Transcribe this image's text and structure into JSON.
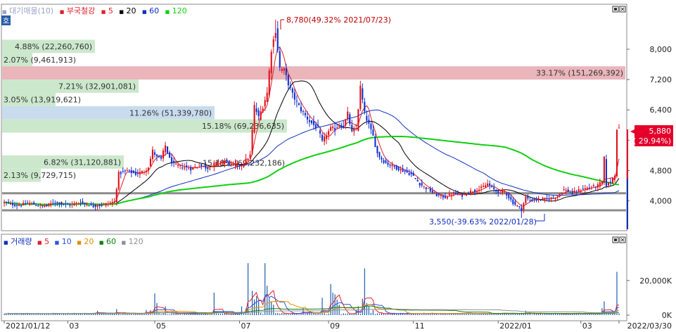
{
  "price_panel": {
    "menu_button_label": "호",
    "legend": [
      {
        "label": "대기매물(10)",
        "color": "#9aa4c8"
      },
      {
        "label": "부국철강",
        "color": "#e0202a"
      },
      {
        "label": "5",
        "color": "#e0202a"
      },
      {
        "label": "20",
        "color": "#000000"
      },
      {
        "label": "60",
        "color": "#1030c0"
      },
      {
        "label": "120",
        "color": "#10d010"
      }
    ],
    "legend_markers": [
      "■",
      "■",
      "■",
      "■",
      "■",
      "■"
    ],
    "max_annotation": "8,780(49.32% 2021/07/23)",
    "min_annotation": "3,550(-39.63% 2022/01/28)",
    "current_price": "5,880",
    "current_change": "( 29.94%)"
  },
  "volume_panel": {
    "legend": [
      {
        "label": "거래량",
        "color": "#1030c0"
      },
      {
        "label": "5",
        "color": "#e0202a"
      },
      {
        "label": "10",
        "color": "#3050e0"
      },
      {
        "label": "20",
        "color": "#e09000"
      },
      {
        "label": "60",
        "color": "#108010"
      },
      {
        "label": "120",
        "color": "#909090"
      }
    ],
    "legend_markers": [
      "■",
      "■",
      "■",
      "■",
      "■",
      "■"
    ]
  },
  "chart_data": {
    "type": "candlestick",
    "price_axis_ticks": [
      "8,000",
      "7,200",
      "6,400",
      "5,600",
      "4,800",
      "4,000"
    ],
    "price_axis_values": [
      8000,
      7200,
      6400,
      5600,
      4800,
      4000
    ],
    "ylim": [
      3250,
      9150
    ],
    "volume_axis_ticks": [
      "20,000K",
      "0K"
    ],
    "volume_axis_values": [
      20000,
      0
    ],
    "volume_ylim": [
      0,
      39000
    ],
    "x_ticks": [
      {
        "label": "2021/01/12",
        "i": 0
      },
      {
        "label": "03",
        "i": 30
      },
      {
        "label": "05",
        "i": 71
      },
      {
        "label": "07",
        "i": 111
      },
      {
        "label": "09",
        "i": 153
      },
      {
        "label": "11",
        "i": 193
      },
      {
        "label": "2022/01",
        "i": 233
      },
      {
        "label": "03",
        "i": 272
      },
      {
        "label": "2022/03/30",
        "i": 290
      }
    ],
    "n_days": 291,
    "close_anchors": [
      [
        0,
        3960
      ],
      [
        6,
        3880
      ],
      [
        12,
        3940
      ],
      [
        18,
        3850
      ],
      [
        24,
        3960
      ],
      [
        30,
        3890
      ],
      [
        36,
        3960
      ],
      [
        42,
        3860
      ],
      [
        48,
        3920
      ],
      [
        52,
        3980
      ],
      [
        54,
        4720
      ],
      [
        58,
        4800
      ],
      [
        62,
        4710
      ],
      [
        66,
        4780
      ],
      [
        68,
        4900
      ],
      [
        70,
        5320
      ],
      [
        72,
        5150
      ],
      [
        74,
        5100
      ],
      [
        76,
        5460
      ],
      [
        78,
        5100
      ],
      [
        80,
        4950
      ],
      [
        84,
        4900
      ],
      [
        88,
        4850
      ],
      [
        92,
        4930
      ],
      [
        96,
        4870
      ],
      [
        100,
        5000
      ],
      [
        104,
        5050
      ],
      [
        108,
        4950
      ],
      [
        112,
        4950
      ],
      [
        116,
        5200
      ],
      [
        118,
        6500
      ],
      [
        120,
        6200
      ],
      [
        122,
        6500
      ],
      [
        124,
        6850
      ],
      [
        126,
        8000
      ],
      [
        128,
        8500
      ],
      [
        130,
        7500
      ],
      [
        132,
        7450
      ],
      [
        134,
        7100
      ],
      [
        136,
        6800
      ],
      [
        140,
        6400
      ],
      [
        144,
        6100
      ],
      [
        148,
        5900
      ],
      [
        150,
        5550
      ],
      [
        152,
        5750
      ],
      [
        154,
        5900
      ],
      [
        156,
        5900
      ],
      [
        158,
        6000
      ],
      [
        160,
        5950
      ],
      [
        162,
        6300
      ],
      [
        164,
        5800
      ],
      [
        166,
        5900
      ],
      [
        168,
        7000
      ],
      [
        170,
        6300
      ],
      [
        172,
        6000
      ],
      [
        174,
        5700
      ],
      [
        176,
        5250
      ],
      [
        178,
        5100
      ],
      [
        180,
        5000
      ],
      [
        184,
        4900
      ],
      [
        188,
        4800
      ],
      [
        192,
        4700
      ],
      [
        196,
        4450
      ],
      [
        200,
        4300
      ],
      [
        204,
        4150
      ],
      [
        208,
        4100
      ],
      [
        212,
        4200
      ],
      [
        216,
        4150
      ],
      [
        220,
        4250
      ],
      [
        224,
        4300
      ],
      [
        228,
        4450
      ],
      [
        232,
        4250
      ],
      [
        236,
        4250
      ],
      [
        240,
        3950
      ],
      [
        244,
        3780
      ],
      [
        246,
        4100
      ],
      [
        248,
        4000
      ],
      [
        252,
        4050
      ],
      [
        256,
        4050
      ],
      [
        260,
        4100
      ],
      [
        264,
        4300
      ],
      [
        268,
        4200
      ],
      [
        272,
        4300
      ],
      [
        276,
        4350
      ],
      [
        280,
        4400
      ],
      [
        282,
        4500
      ],
      [
        283,
        5120
      ],
      [
        284,
        4420
      ],
      [
        286,
        4500
      ],
      [
        288,
        4700
      ],
      [
        289,
        5880
      ]
    ],
    "volume_spikes": [
      [
        44,
        2500
      ],
      [
        53,
        3500
      ],
      [
        67,
        3000
      ],
      [
        69,
        2800
      ],
      [
        71,
        12500
      ],
      [
        72,
        7000
      ],
      [
        76,
        5000
      ],
      [
        99,
        13000
      ],
      [
        112,
        5000
      ],
      [
        114,
        3800
      ],
      [
        115,
        30000
      ],
      [
        117,
        14000
      ],
      [
        118,
        9000
      ],
      [
        119,
        11000
      ],
      [
        120,
        8000
      ],
      [
        123,
        30000
      ],
      [
        124,
        17000
      ],
      [
        125,
        10000
      ],
      [
        126,
        8000
      ],
      [
        127,
        6000
      ],
      [
        141,
        4000
      ],
      [
        150,
        10000
      ],
      [
        154,
        18000
      ],
      [
        155,
        13000
      ],
      [
        156,
        12000
      ],
      [
        157,
        9000
      ],
      [
        158,
        6000
      ],
      [
        166,
        3000
      ],
      [
        167,
        5000
      ],
      [
        169,
        9500
      ],
      [
        170,
        27000
      ],
      [
        171,
        7000
      ],
      [
        172,
        5000
      ],
      [
        174,
        3000
      ],
      [
        246,
        2500
      ],
      [
        282,
        4000
      ],
      [
        283,
        8000
      ],
      [
        289,
        25000
      ]
    ],
    "volume_base": 900,
    "ma_periods": [
      5,
      20,
      60,
      120
    ],
    "ma_colors": [
      "#e0202a",
      "#000000",
      "#1030c0",
      "#10d010"
    ],
    "supply_zones": [
      {
        "label": "4.88% (22,260,760)",
        "low": 7900,
        "high": 8250,
        "bar_right": 135
      },
      {
        "label": "2.07% (9,461,913)",
        "low": 7550,
        "high": 7900,
        "bar_right": 46
      },
      {
        "label": "33.17% (151,269,392)",
        "low": 7200,
        "high": 7550,
        "bar_right": 889
      },
      {
        "label": "7.21% (32,901,081)",
        "low": 6850,
        "high": 7200,
        "bar_right": 197
      },
      {
        "label": "3.05% (13,919,621)",
        "low": 6500,
        "high": 6850,
        "bar_right": 79
      },
      {
        "label": "11.26% (51,339,780)",
        "low": 6150,
        "high": 6500,
        "bar_right": 305
      },
      {
        "label": "15.18% (69,236,635)",
        "low": 5800,
        "high": 6150,
        "bar_right": 408
      },
      {
        "label": "6.82% (31,120,881)",
        "low": 4850,
        "high": 5200,
        "bar_right": 176
      },
      {
        "label": "2.13% (9,729,715)",
        "low": 4500,
        "high": 4850,
        "bar_right": 58
      }
    ],
    "overlap_label": "15.18% (69,232,186)",
    "horizontal_lines": [
      4200,
      3750
    ]
  }
}
